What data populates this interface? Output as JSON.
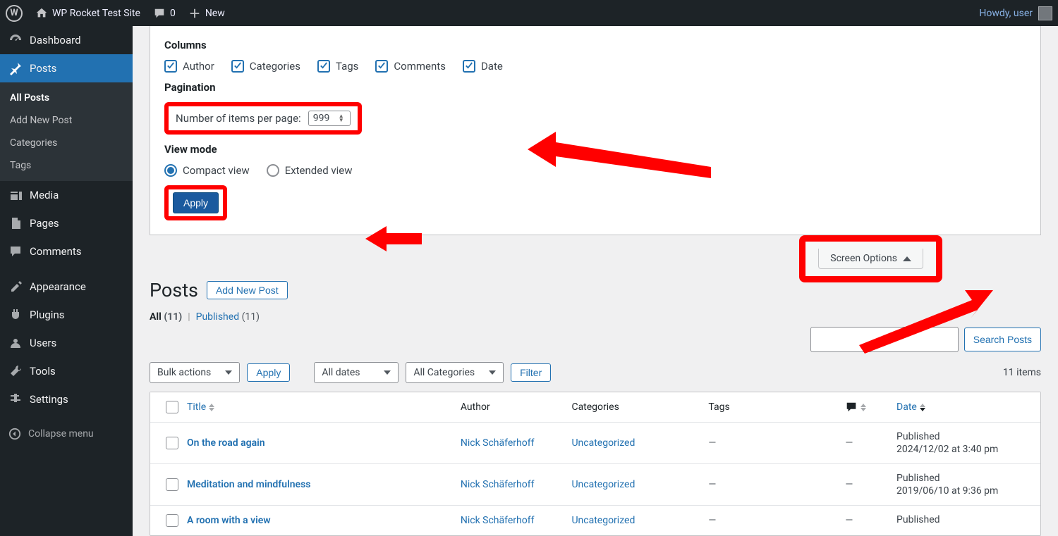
{
  "adminbar": {
    "site_title": "WP Rocket Test Site",
    "comments_count": "0",
    "new_label": "New",
    "howdy": "Howdy, user"
  },
  "sidebar": {
    "dashboard": "Dashboard",
    "posts": "Posts",
    "sub": {
      "all": "All Posts",
      "add": "Add New Post",
      "cats": "Categories",
      "tags": "Tags"
    },
    "media": "Media",
    "pages": "Pages",
    "comments": "Comments",
    "appearance": "Appearance",
    "plugins": "Plugins",
    "users": "Users",
    "tools": "Tools",
    "settings": "Settings",
    "collapse": "Collapse menu"
  },
  "screen_meta": {
    "columns_title": "Columns",
    "cols": {
      "author": "Author",
      "categories": "Categories",
      "tags": "Tags",
      "comments": "Comments",
      "date": "Date"
    },
    "pagination_title": "Pagination",
    "per_page_label": "Number of items per page:",
    "per_page_value": "999",
    "viewmode_title": "View mode",
    "compact": "Compact view",
    "extended": "Extended view",
    "apply": "Apply"
  },
  "screen_tab": "Screen Options",
  "heading": {
    "title": "Posts",
    "add_new": "Add New Post"
  },
  "subsub": {
    "all_label": "All",
    "all_count": "(11)",
    "pipe": "|",
    "pub_label": "Published",
    "pub_count": "(11)"
  },
  "search": {
    "btn": "Search Posts",
    "placeholder": ""
  },
  "filters": {
    "bulk": "Bulk actions",
    "apply": "Apply",
    "dates": "All dates",
    "cats": "All Categories",
    "filter": "Filter",
    "count": "11 items"
  },
  "thead": {
    "title": "Title",
    "author": "Author",
    "categories": "Categories",
    "tags": "Tags",
    "date": "Date"
  },
  "rows": [
    {
      "title": "On the road again",
      "author": "Nick Schäferhoff",
      "cat": "Uncategorized",
      "tags": "—",
      "com": "—",
      "status": "Published",
      "date": "2024/12/02 at 3:40 pm"
    },
    {
      "title": "Meditation and mindfulness",
      "author": "Nick Schäferhoff",
      "cat": "Uncategorized",
      "tags": "—",
      "com": "—",
      "status": "Published",
      "date": "2019/06/10 at 9:36 pm"
    },
    {
      "title": "A room with a view",
      "author": "Nick Schäferhoff",
      "cat": "Uncategorized",
      "tags": "—",
      "com": "—",
      "status": "Published",
      "date": ""
    }
  ]
}
